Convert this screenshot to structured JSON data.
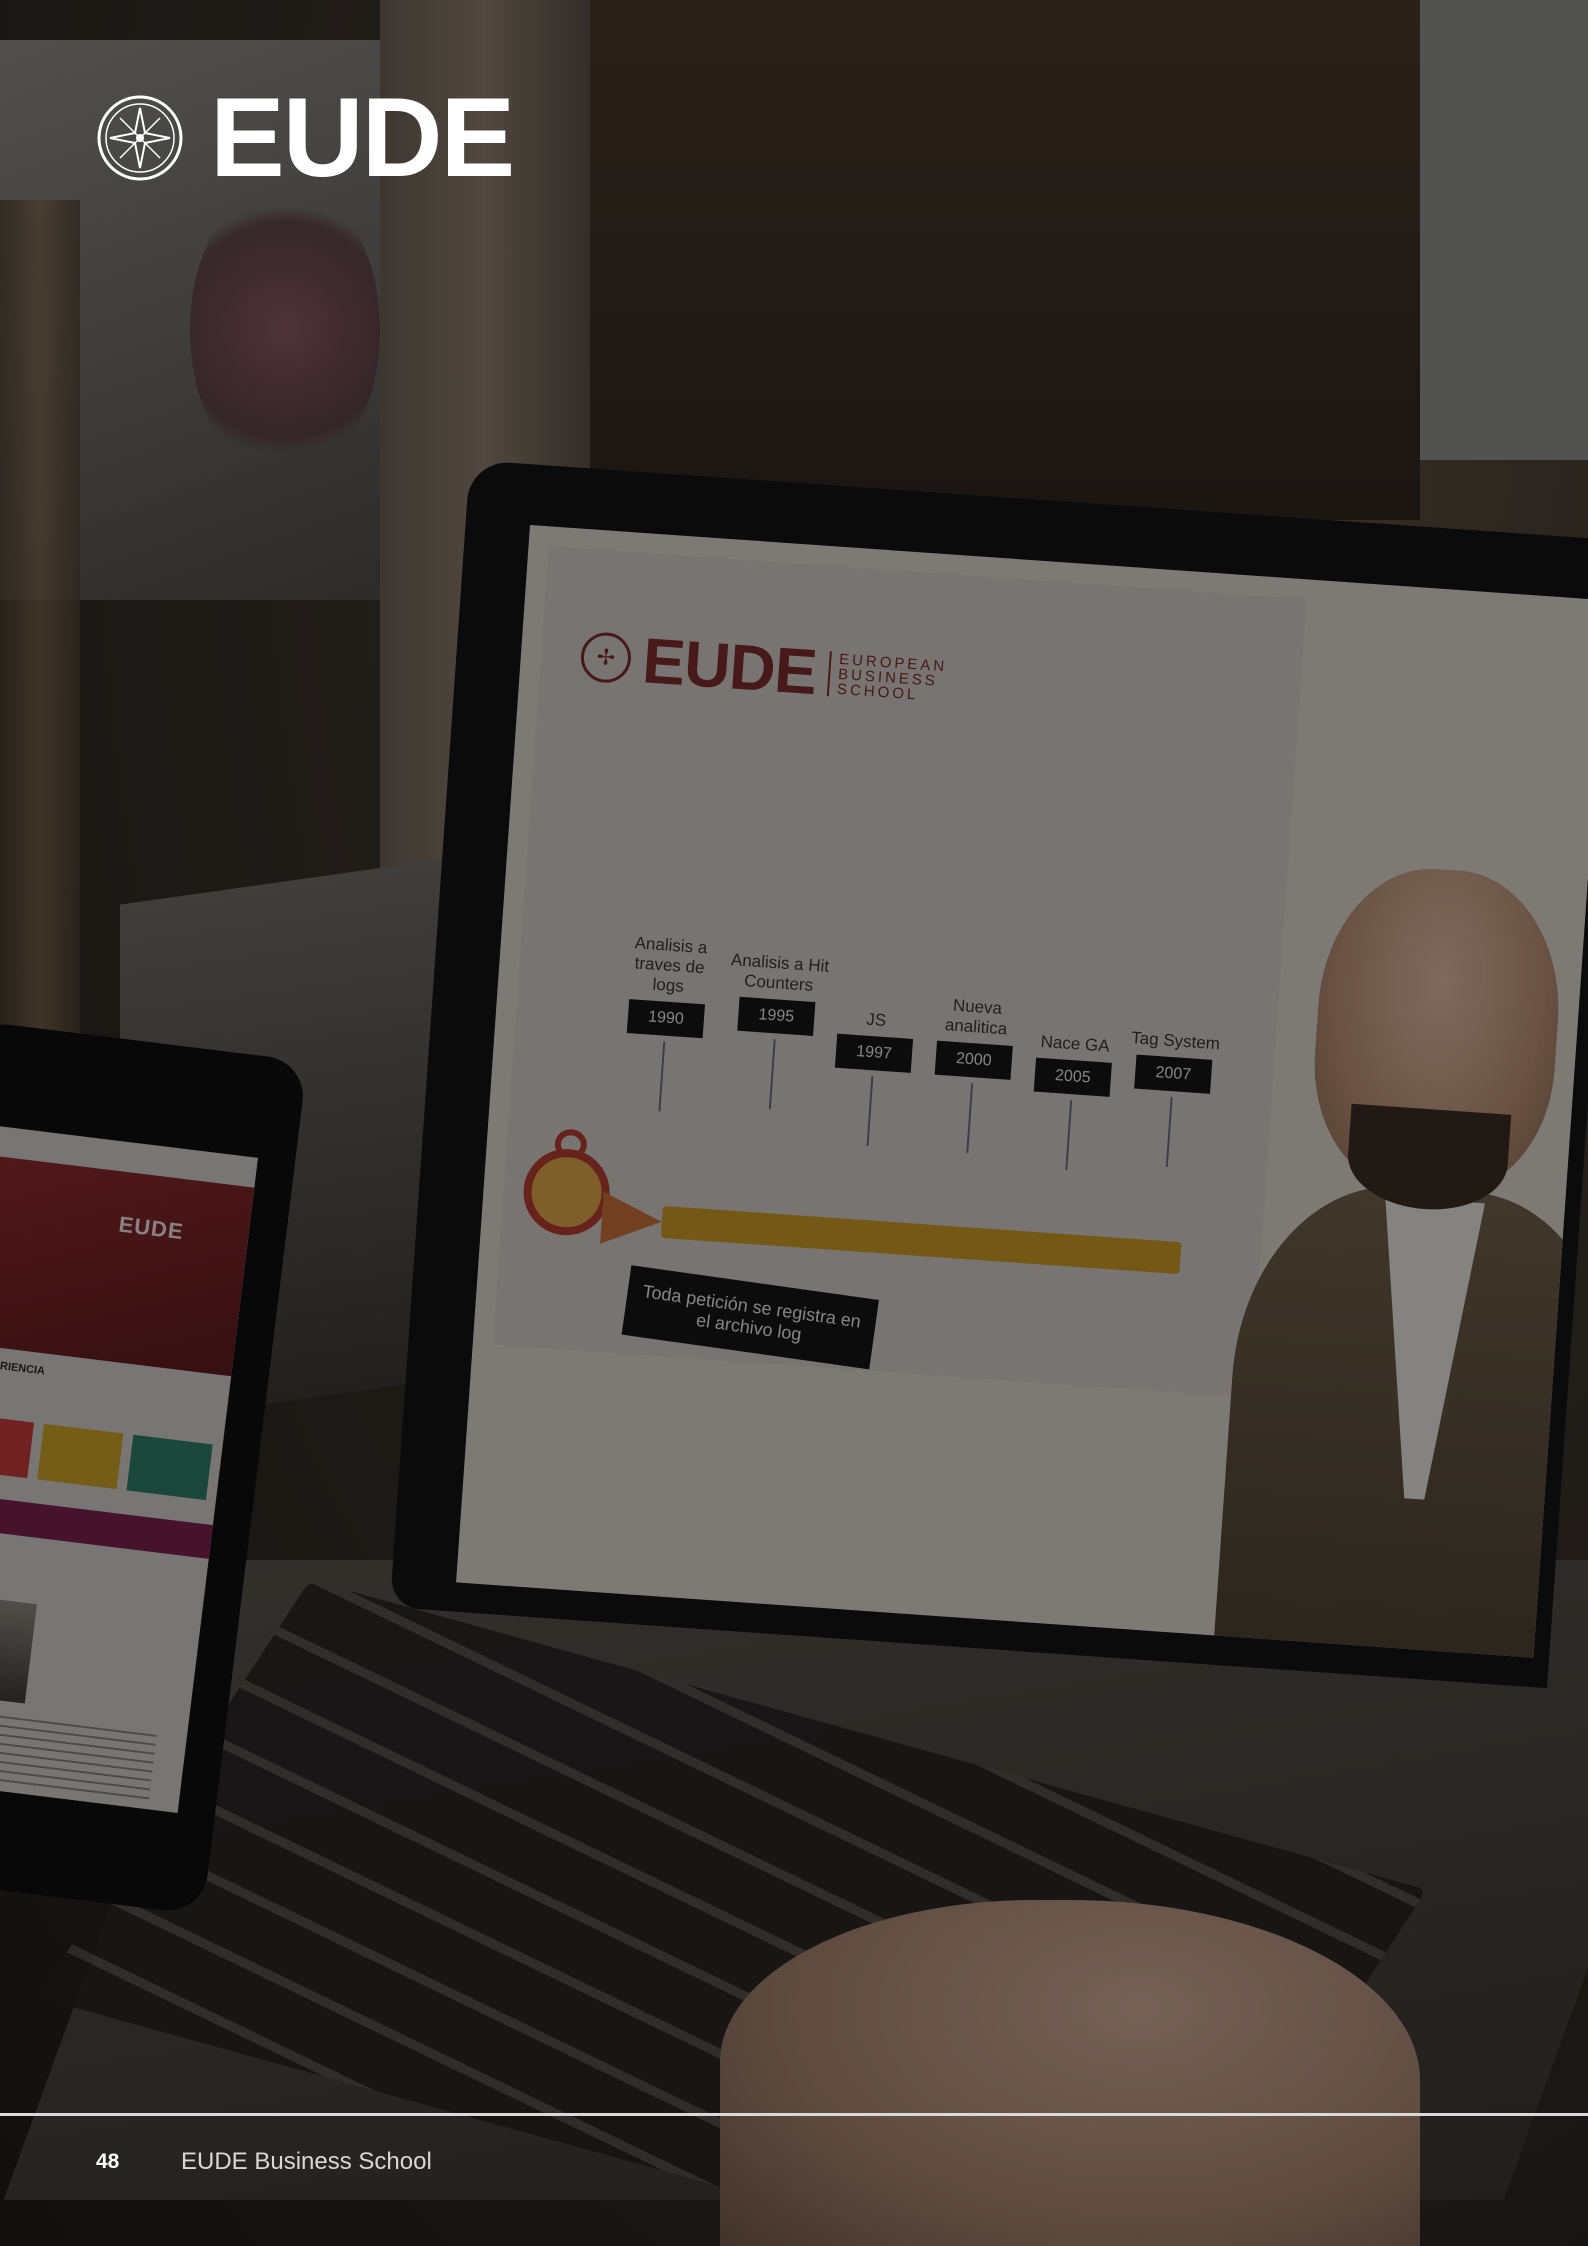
{
  "header": {
    "brand_name": "EUDE",
    "logo_icon": "compass-star-emblem-icon"
  },
  "photo": {
    "laptop_slide": {
      "brand_word": "EUDE",
      "brand_sub": "EUROPEAN BUSINESS SCHOOL",
      "timeline": [
        {
          "caption": "Analisis a traves de logs",
          "year": "1990"
        },
        {
          "caption": "Analisis a Hit Counters",
          "year": "1995"
        },
        {
          "caption": "JS",
          "year": "1997"
        },
        {
          "caption": "Nueva analitica",
          "year": "2000"
        },
        {
          "caption": "Nace GA",
          "year": "2005"
        },
        {
          "caption": "Tag System",
          "year": "2007"
        }
      ],
      "callout": "Toda petición se registra en el archivo log"
    },
    "phone_screen": {
      "hero_word": "EUDE",
      "section_label": "EXPERIENCIA",
      "tile_colors": [
        "#c23a3a",
        "#c8a127",
        "#2f7a64"
      ],
      "bar_color": "#7a1f4c"
    }
  },
  "footer": {
    "page_number": "48",
    "publication": "EUDE Business School"
  },
  "colors": {
    "overlay": "rgba(0,0,0,0.42)",
    "brand_burgundy": "#7a2b2e",
    "timeline_yellow": "#c79a25",
    "text_white": "#ffffff"
  }
}
